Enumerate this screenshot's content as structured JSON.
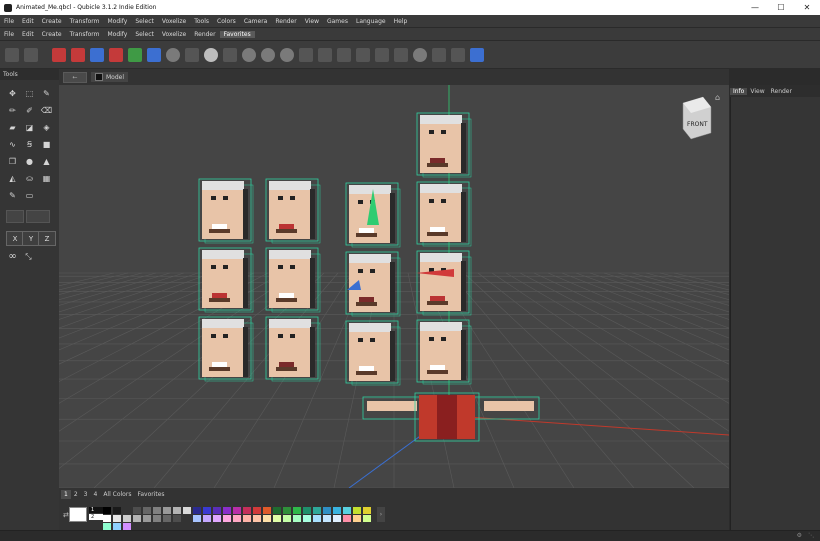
{
  "window": {
    "title": "Animated_Me.qbcl - Qubicle 3.1.2 Indie Edition",
    "minimize": "—",
    "maximize": "☐",
    "close": "✕"
  },
  "menu_main": [
    "File",
    "Edit",
    "Create",
    "Transform",
    "Modify",
    "Select",
    "Voxelize",
    "Tools",
    "Colors",
    "Camera",
    "Render",
    "View",
    "Games",
    "Language",
    "Help"
  ],
  "menu_sub": [
    "File",
    "Edit",
    "Create",
    "Transform",
    "Modify",
    "Select",
    "Voxelize",
    "Render",
    "Favorites"
  ],
  "menu_sub_active": "Favorites",
  "toolbar_icons": [
    "refresh-icon",
    "sync-icon",
    "mirror-x-red-icon",
    "mirror-y-red-icon",
    "mirror-z-blue-icon",
    "mirror-x-red2-icon",
    "flip-y-green-icon",
    "flip-z-blue-icon",
    "target-icon",
    "grid-icon",
    "color-wheel-icon",
    "fill-icon",
    "eye-icon",
    "eye-open-icon",
    "eye-closed-icon",
    "ruler-icon",
    "pen-icon",
    "voxel-count-icon",
    "symmetry-icon",
    "triangle-icon",
    "merge-icon",
    "rotate-icon",
    "expand-icon",
    "fit-icon",
    "layers-icon"
  ],
  "tools": {
    "title": "Tools",
    "axis_buttons": [
      "X",
      "Y",
      "Z"
    ]
  },
  "breadcrumb": {
    "back": "←",
    "model": "Model"
  },
  "viewcube": {
    "label": "FRONT"
  },
  "right_panel": {
    "tabs": [
      "Info",
      "View",
      "Render"
    ],
    "active": "Info"
  },
  "palette": {
    "tabs": [
      "1",
      "2",
      "3",
      "4",
      "All Colors",
      "Favorites"
    ],
    "active": "1",
    "slot_a": "1",
    "slot_b": "2",
    "colors": [
      "#000000",
      "#1a1a1a",
      "#333333",
      "#4d4d4d",
      "#666666",
      "#808080",
      "#999999",
      "#b3b3b3",
      "#d9d9d9",
      "#2b2b8f",
      "#3a3ad1",
      "#5a2fb8",
      "#8a2fc9",
      "#b82fa8",
      "#c42f5a",
      "#d13a3a",
      "#e05a2a",
      "#1f6b2f",
      "#2f8f3a",
      "#2fb84a",
      "#1f8f6b",
      "#2fa89a",
      "#2f8fc4",
      "#3ab4e0",
      "#5ad1e0",
      "#c4e02f",
      "#e0d12f",
      "#ffffff",
      "#e6e6e6",
      "#cccccc",
      "#b3b3b3",
      "#999999",
      "#808080",
      "#666666",
      "#4d4d4d",
      "#333333",
      "#a8c4ff",
      "#c4a8ff",
      "#e0a8ff",
      "#ffa8e0",
      "#ffa8c4",
      "#ffb3a8",
      "#ffc4a8",
      "#ffe0a8",
      "#e0ffa8",
      "#c4ffa8",
      "#a8ffc4",
      "#a8ffe0",
      "#a8e0ff",
      "#c4e6ff",
      "#e0f0ff",
      "#ff8fa8",
      "#ffd18f",
      "#d1ff8f",
      "#8fffd1",
      "#8fd1ff",
      "#d18fff"
    ]
  }
}
